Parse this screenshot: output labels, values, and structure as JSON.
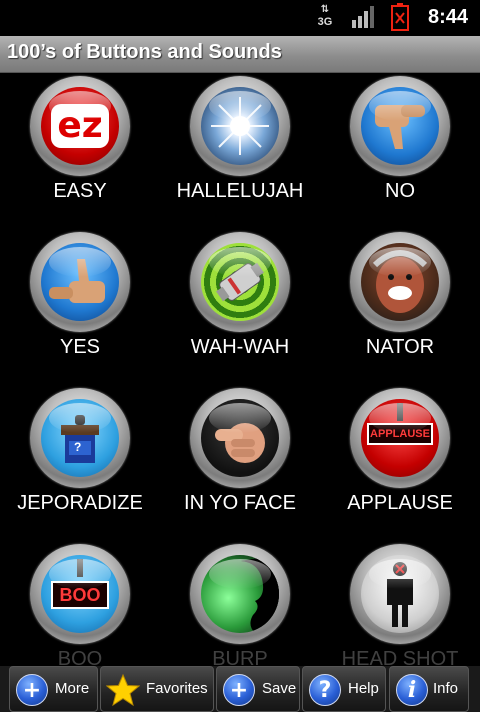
{
  "status": {
    "network": "3G",
    "time": "8:44"
  },
  "title": "100’s of Buttons and Sounds",
  "buttons": [
    {
      "label": "EASY"
    },
    {
      "label": "HALLELUJAH"
    },
    {
      "label": "NO"
    },
    {
      "label": "YES"
    },
    {
      "label": "WAH-WAH"
    },
    {
      "label": "NATOR"
    },
    {
      "label": "JEPORADIZE"
    },
    {
      "label": "IN YO FACE"
    },
    {
      "label": "APPLAUSE"
    },
    {
      "label": "BOO"
    },
    {
      "label": "BURP"
    },
    {
      "label": "HEAD SHOT"
    }
  ],
  "icons": {
    "easy": {
      "text": "ez"
    },
    "jeporadize": {
      "text": "?"
    },
    "applause": {
      "text": "APPLAUSE"
    },
    "boo": {
      "text": "BOO"
    }
  },
  "toolbar": {
    "more": "More",
    "favorites": "Favorites",
    "save": "Save",
    "help": "Help",
    "info": "Info"
  }
}
